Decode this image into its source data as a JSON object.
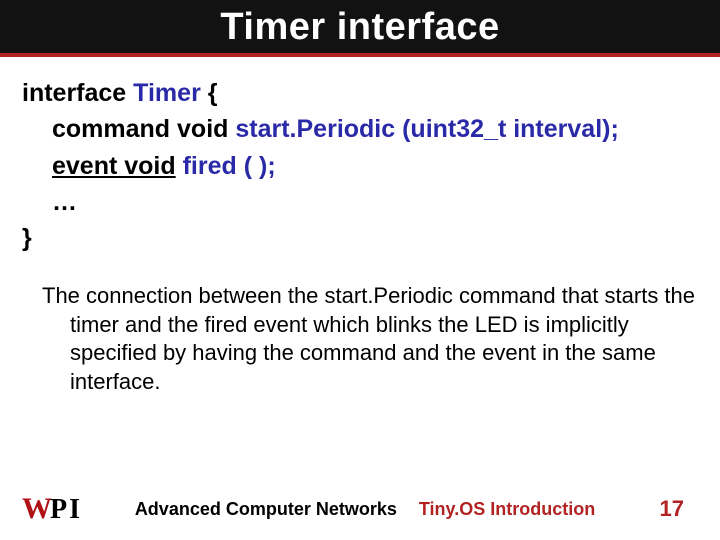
{
  "title": "Timer interface",
  "code": {
    "l1_kw": "interface",
    "l1_name": "Timer",
    "l1_brace": "{",
    "l2_kw": "command void",
    "l2_rest": "start.Periodic (uint32_t interval);",
    "l3_kw": "event void",
    "l3_rest": "fired ( );",
    "l4": "…",
    "l5": "}"
  },
  "paragraph": "The connection between the start.Periodic command that starts the timer and the fired event which blinks the LED is implicitly specified by having the command and the event in the same interface.",
  "footer": {
    "left_logo": "WPI",
    "center_black": "Advanced Computer Networks",
    "center_red": "Tiny.OS Introduction",
    "page": "17"
  }
}
